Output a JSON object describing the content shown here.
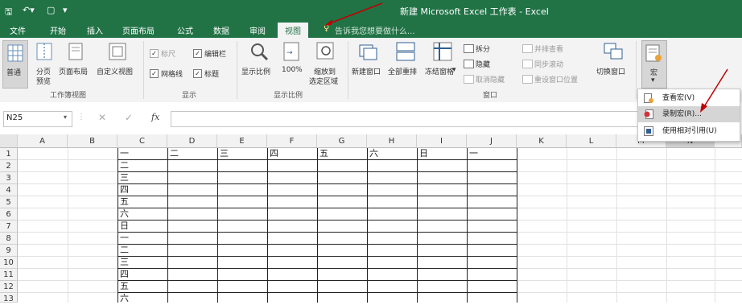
{
  "titlebar": {
    "title": "新建 Microsoft Excel 工作表 - Excel"
  },
  "tabs": [
    {
      "label": "文件"
    },
    {
      "label": "开始"
    },
    {
      "label": "插入"
    },
    {
      "label": "页面布局"
    },
    {
      "label": "公式"
    },
    {
      "label": "数据"
    },
    {
      "label": "审阅"
    },
    {
      "label": "视图"
    }
  ],
  "tellme": {
    "placeholder": "告诉我您想要做什么..."
  },
  "ribbon": {
    "workbook_views": {
      "normal": "普通",
      "page_break_1": "分页",
      "page_break_2": "预览",
      "page_layout": "页面布局",
      "custom": "自定义视图",
      "group": "工作簿视图"
    },
    "show": {
      "ruler": "标尺",
      "formula_bar": "编辑栏",
      "gridlines": "网格线",
      "headings": "标题",
      "group": "显示"
    },
    "zoom": {
      "zoom": "显示比例",
      "zoom100": "100%",
      "zoom_sel_1": "缩放到",
      "zoom_sel_2": "选定区域",
      "group": "显示比例"
    },
    "window": {
      "new_window": "新建窗口",
      "arrange_all": "全部重排",
      "freeze": "冻结窗格",
      "split": "拆分",
      "hide": "隐藏",
      "unhide": "取消隐藏",
      "side_by_side": "并排查看",
      "sync_scroll": "同步滚动",
      "reset_pos": "重设窗口位置",
      "switch": "切换窗口",
      "group": "窗口"
    },
    "macros": {
      "label": "宏"
    }
  },
  "namebox": {
    "value": "N25"
  },
  "formula": {
    "fx": "fx",
    "value": ""
  },
  "columns": [
    "A",
    "B",
    "C",
    "D",
    "E",
    "F",
    "G",
    "H",
    "I",
    "J",
    "K",
    "L",
    "M",
    "N"
  ],
  "rows": [
    "1",
    "2",
    "3",
    "4",
    "5",
    "6",
    "7",
    "8",
    "9",
    "10",
    "11",
    "12",
    "13"
  ],
  "cells": {
    "C": [
      "一",
      "二",
      "三",
      "四",
      "五",
      "六",
      "日",
      "一",
      "二",
      "三",
      "四",
      "五",
      "六"
    ],
    "row1": {
      "D": "二",
      "E": "三",
      "F": "四",
      "G": "五",
      "H": "六",
      "I": "日",
      "J": "一"
    }
  },
  "macro_menu": {
    "view": "查看宏(V)",
    "record": "录制宏(R)...",
    "relative": "使用相对引用(U)"
  },
  "colors": {
    "excel_green": "#217346",
    "annotation_red": "#c00000"
  }
}
